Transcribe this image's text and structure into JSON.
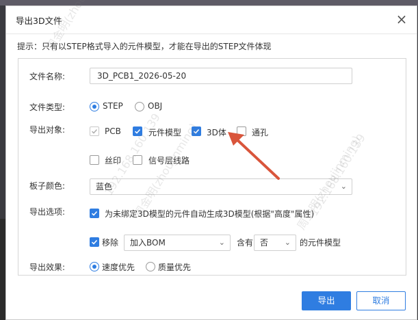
{
  "dialog": {
    "title": "导出3D文件",
    "close_icon": "close-icon",
    "hint": "提示：只有以STEP格式导入的元件模型，才能在导出的STEP文件体现"
  },
  "filename": {
    "label": "文件名称:",
    "value": "3D_PCB1_2026-05-20"
  },
  "filetype": {
    "label": "文件类型:",
    "options": [
      "STEP",
      "OBJ"
    ],
    "selected": "STEP"
  },
  "export_objects": {
    "label": "导出对象:",
    "items": [
      {
        "label": "PCB",
        "checked": true,
        "disabled": true
      },
      {
        "label": "元件模型",
        "checked": true,
        "disabled": false
      },
      {
        "label": "3D体",
        "checked": true,
        "disabled": false
      },
      {
        "label": "通孔",
        "checked": false,
        "disabled": false
      },
      {
        "label": "丝印",
        "checked": false,
        "disabled": false
      },
      {
        "label": "信号层线路",
        "checked": false,
        "disabled": false
      }
    ]
  },
  "board_color": {
    "label": "板子颜色:",
    "value": "蓝色"
  },
  "export_options": {
    "label": "导出选项:",
    "auto_generate": {
      "checked": true,
      "label": "为未绑定3D模型的元件自动生成3D模型(根据\"高度\"属性)"
    },
    "remove": {
      "checked": true,
      "label": "移除",
      "select_value": "加入BOM",
      "middle_label": "含有",
      "select2_value": "否",
      "suffix": "的元件模型"
    }
  },
  "export_effect": {
    "label": "导出效果:",
    "options": [
      "速度优先",
      "质量优先"
    ],
    "selected": "速度优先"
  },
  "buttons": {
    "export": "导出",
    "cancel": "取消"
  },
  "watermark": {
    "text": "周金明(zhoujinming)",
    "ip": "192.168.160.139"
  },
  "colors": {
    "accent": "#2f7de1",
    "arrow": "#d9553b"
  }
}
